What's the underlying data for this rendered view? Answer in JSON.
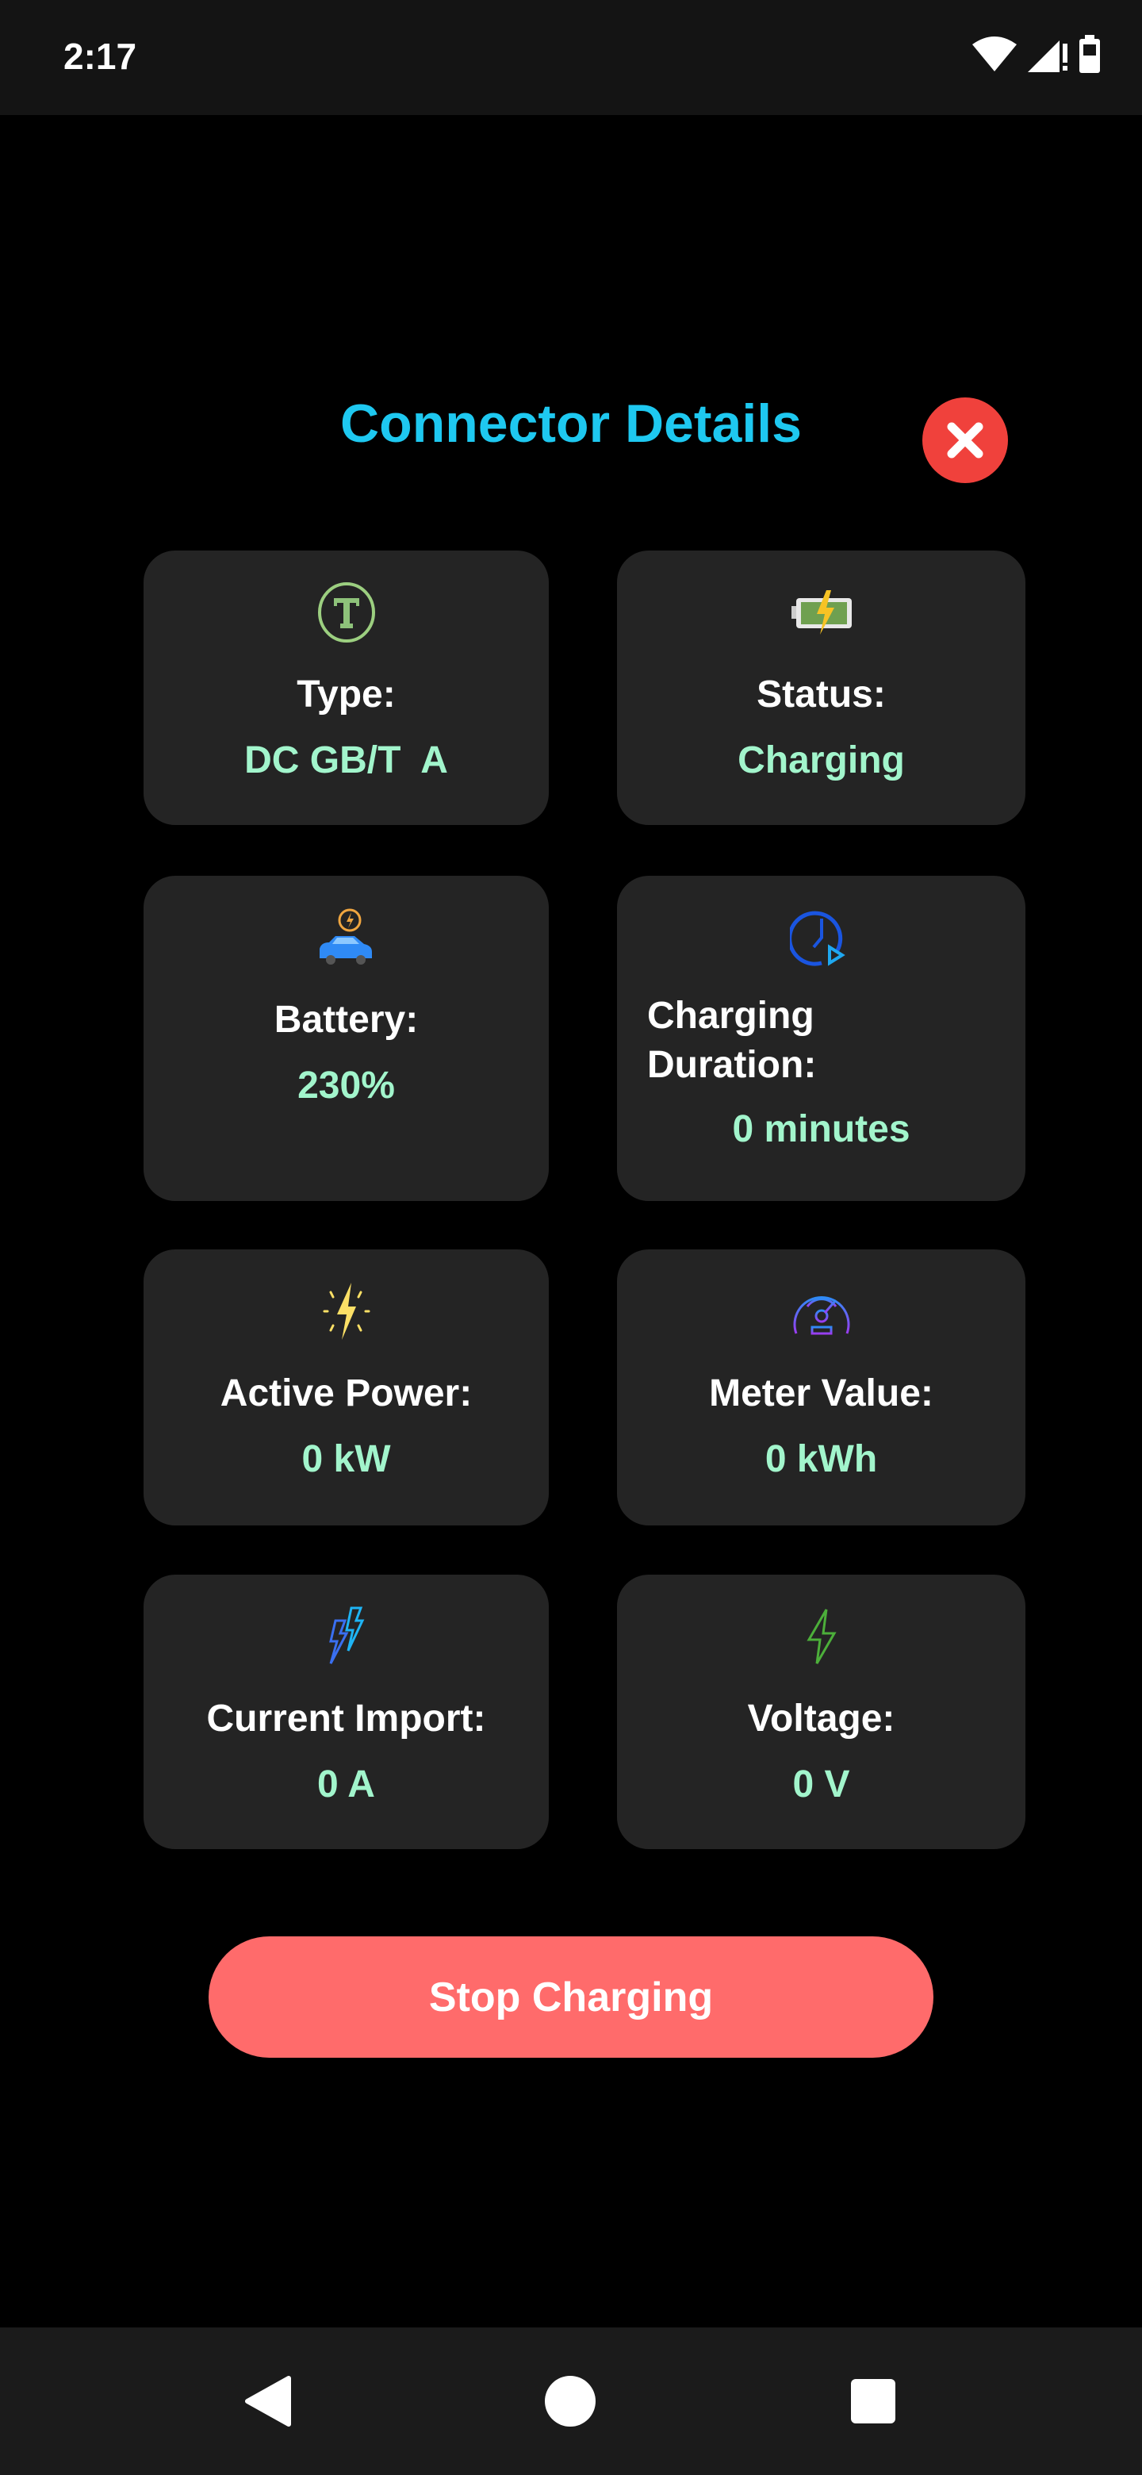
{
  "status_bar": {
    "time": "2:17",
    "icons": [
      "wifi-icon",
      "signal-icon",
      "battery-icon"
    ]
  },
  "dialog": {
    "title": "Connector Details",
    "close_icon": "close-icon",
    "cards": [
      {
        "icon": "type-t-icon",
        "label": "Type:",
        "value": "DC GB/T  A"
      },
      {
        "icon": "battery-charging-icon",
        "label": "Status:",
        "value": "Charging"
      },
      {
        "icon": "car-charging-icon",
        "label": "Battery:",
        "value": "230%"
      },
      {
        "icon": "clock-play-icon",
        "label": "Charging Duration:",
        "value": "0 minutes"
      },
      {
        "icon": "lightning-icon",
        "label": "Active Power:",
        "value": "0 kW"
      },
      {
        "icon": "meter-gauge-icon",
        "label": "Meter Value:",
        "value": "0 kWh"
      },
      {
        "icon": "double-bolt-icon",
        "label": "Current Import:",
        "value": "0 A"
      },
      {
        "icon": "bolt-outline-icon",
        "label": "Voltage:",
        "value": "0 V"
      }
    ],
    "stop_button": "Stop Charging"
  },
  "colors": {
    "title": "#1ec8f0",
    "value": "#a2f5cc",
    "card": "#242424",
    "stop": "#ff6b6b",
    "close": "#f0413c"
  },
  "nav_bar": {
    "icons": [
      "back-icon",
      "home-icon",
      "recents-icon"
    ]
  }
}
